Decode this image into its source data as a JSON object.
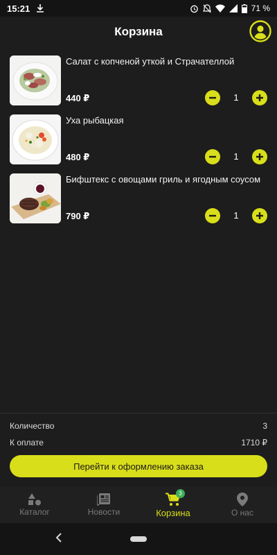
{
  "status_bar": {
    "time": "15:21",
    "battery": "71 %"
  },
  "header": {
    "title": "Корзина"
  },
  "cart": {
    "items": [
      {
        "name": "Салат с копченой уткой и Страчателлой",
        "price": "440 ₽",
        "quantity": "1"
      },
      {
        "name": "Уха рыбацкая",
        "price": "480 ₽",
        "quantity": "1"
      },
      {
        "name": "Бифштекс с овощами гриль и ягодным соусом",
        "price": "790 ₽",
        "quantity": "1"
      }
    ]
  },
  "summary": {
    "quantity_label": "Количество",
    "quantity_value": "3",
    "total_label": "К оплате",
    "total_value": "1710 ₽",
    "checkout_label": "Перейти к оформлению заказа"
  },
  "bottom_nav": {
    "items": [
      {
        "label": "Каталог",
        "icon": "catalog-icon"
      },
      {
        "label": "Новости",
        "icon": "news-icon"
      },
      {
        "label": "Корзина",
        "icon": "cart-icon",
        "badge": "3"
      },
      {
        "label": "О нас",
        "icon": "location-pin-icon"
      }
    ],
    "active": "Корзина"
  },
  "colors": {
    "accent": "#d9de1a",
    "background": "#1d1d1d",
    "badge": "#3fae5a"
  }
}
